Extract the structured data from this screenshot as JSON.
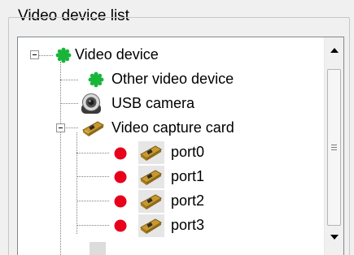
{
  "groupbox": {
    "title": "Video device list"
  },
  "tree": {
    "root": {
      "label": "Video device",
      "icon": "green-gear-icon",
      "status_color": "#19b53a"
    },
    "children": [
      {
        "label": "Other video device",
        "icon": "green-gear-icon",
        "status_color": "#19b53a"
      },
      {
        "label": "USB camera",
        "icon": "usb-camera-icon"
      },
      {
        "label": "Video capture card",
        "icon": "capture-card-icon"
      }
    ],
    "ports": [
      {
        "label": "port0",
        "status_icon": "red-dot-icon",
        "status_color": "#e8001c",
        "icon": "capture-card-icon"
      },
      {
        "label": "port1",
        "status_icon": "red-dot-icon",
        "status_color": "#e8001c",
        "icon": "capture-card-icon"
      },
      {
        "label": "port2",
        "status_icon": "red-dot-icon",
        "status_color": "#e8001c",
        "icon": "capture-card-icon"
      },
      {
        "label": "port3",
        "status_icon": "red-dot-icon",
        "status_color": "#e8001c",
        "icon": "capture-card-icon"
      }
    ]
  }
}
